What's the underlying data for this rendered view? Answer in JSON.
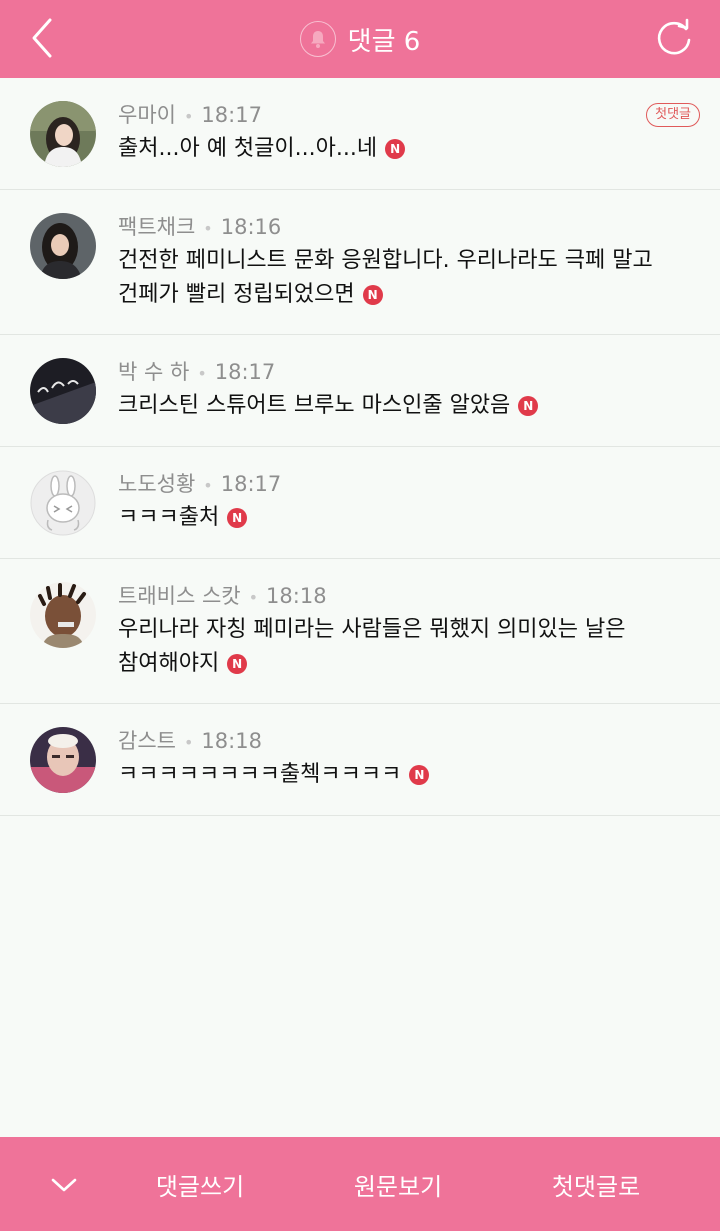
{
  "header": {
    "title": "댓글 6",
    "accent": "#ef7399"
  },
  "comments": [
    {
      "author": "우마이",
      "time": "18:17",
      "text": "출처...아 예 첫글이...아...네",
      "badge": "N",
      "tag": "첫댓글"
    },
    {
      "author": "팩트채크",
      "time": "18:16",
      "text": "건전한 페미니스트 문화 응원합니다. 우리나라도 극페 말고 건페가 빨리 정립되었으면",
      "badge": "N"
    },
    {
      "author": "박 수 하",
      "time": "18:17",
      "text": "크리스틴 스튜어트 브루노 마스인줄 알았음",
      "badge": "N"
    },
    {
      "author": "노도성황",
      "time": "18:17",
      "text": "ㅋㅋㅋ출처",
      "badge": "N"
    },
    {
      "author": "트래비스 스캇",
      "time": "18:18",
      "text": "우리나라 자칭 페미라는 사람들은 뭐했지 의미있는 날은 참여해야지",
      "badge": "N"
    },
    {
      "author": "감스트",
      "time": "18:18",
      "text": "ㅋㅋㅋㅋㅋㅋㅋㅋ출첵ㅋㅋㅋㅋ",
      "badge": "N"
    }
  ],
  "footer": {
    "write": "댓글쓰기",
    "original": "원문보기",
    "first": "첫댓글로"
  },
  "icons": {
    "back": "chevron-left-icon",
    "bell": "bell-icon",
    "refresh": "refresh-icon",
    "collapse": "chevron-down-icon"
  }
}
